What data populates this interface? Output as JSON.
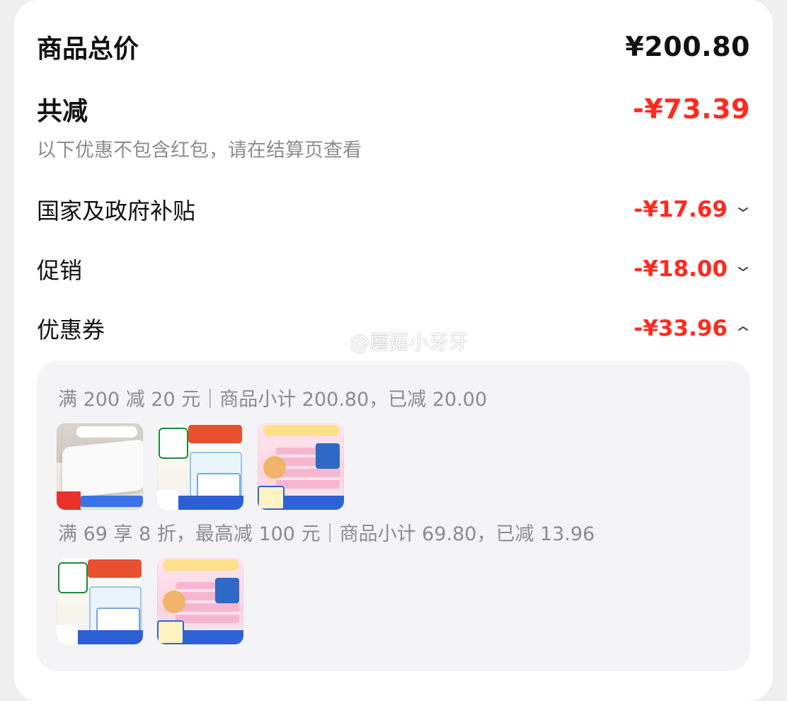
{
  "summary": {
    "total_label": "商品总价",
    "total_value": "¥200.80",
    "reduce_label": "共减",
    "reduce_value": "-¥73.39",
    "hint": "以下优惠不包含红包，请在结算页查看"
  },
  "discounts": [
    {
      "label": "国家及政府补贴",
      "value": "-¥17.69",
      "state": "collapsed"
    },
    {
      "label": "促销",
      "value": "-¥18.00",
      "state": "collapsed"
    },
    {
      "label": "优惠券",
      "value": "-¥33.96",
      "state": "expanded"
    }
  ],
  "coupons": [
    {
      "text": "满 200 减 20 元｜商品小计 200.80，已减 20.00",
      "products": [
        "mattress",
        "tissue",
        "wipes"
      ]
    },
    {
      "text": "满 69 享 8 折，最高减 100 元｜商品小计 69.80，已减 13.96",
      "products": [
        "tissue",
        "wipes"
      ]
    }
  ],
  "watermark": {
    "text": "@蘑菇小牙牙",
    "icon": "weibo-icon"
  },
  "colors": {
    "accent_red": "#ff2a1f",
    "muted_text": "#8c8c8c",
    "panel_bg": "#f4f4f6"
  }
}
